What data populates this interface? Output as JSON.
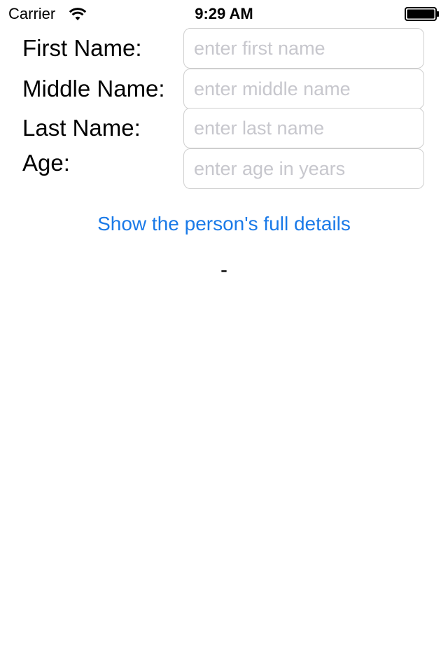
{
  "status_bar": {
    "carrier": "Carrier",
    "time": "9:29 AM",
    "wifi_icon": "wifi-icon",
    "battery_icon": "battery-icon"
  },
  "form": {
    "first_name": {
      "label": "First Name:",
      "value": "",
      "placeholder": "enter first name"
    },
    "middle_name": {
      "label": "Middle Name:",
      "value": "",
      "placeholder": "enter middle name"
    },
    "last_name": {
      "label": "Last Name:",
      "value": "",
      "placeholder": "enter last name"
    },
    "age": {
      "label": "Age:",
      "value": "",
      "placeholder": "enter age in years"
    }
  },
  "actions": {
    "show_details_label": "Show the person's full details"
  },
  "result": {
    "text": "-"
  },
  "colors": {
    "accent": "#1a7ae8",
    "placeholder": "#c7c7cd",
    "field_border": "#cfcfcf"
  }
}
